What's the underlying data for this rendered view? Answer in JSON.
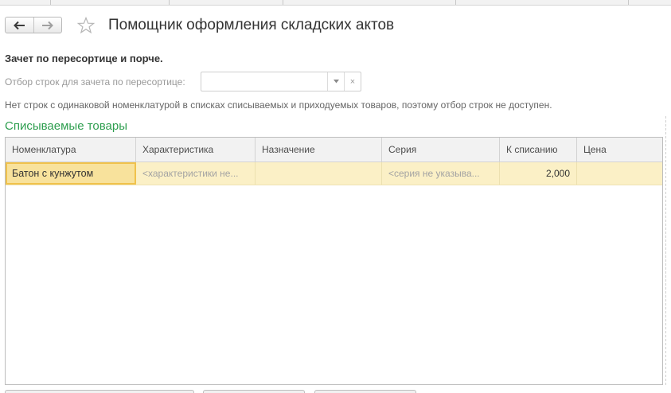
{
  "page_title": "Помощник оформления складских актов",
  "section_heading": "Зачет по пересортице и порче.",
  "filter": {
    "label": "Отбор строк для зачета по пересортице:",
    "value": "",
    "dropdown_glyph": "▾",
    "clear_glyph": "×"
  },
  "info_note": "Нет строк с одинаковой номенклатурой в списках списываемых и приходуемых товаров, поэтому отбор строк не доступен.",
  "group_title": "Списываемые товары",
  "table": {
    "columns": [
      "Номенклатура",
      "Характеристика",
      "Назначение",
      "Серия",
      "К списанию",
      "Цена"
    ],
    "rows": [
      {
        "nomenclature": "Батон с кунжутом",
        "characteristic": "<характеристики не...",
        "purpose": "",
        "series": "<серия не указыва...",
        "to_write_off": "2,000",
        "price": ""
      }
    ]
  },
  "colors": {
    "accent_green": "#2e9e4f",
    "row_highlight": "#fbf0c6",
    "active_cell_border": "#f0c24c"
  },
  "icons": {
    "back": "arrow-left-icon",
    "forward": "arrow-right-icon",
    "favorite": "star-icon",
    "dropdown": "chevron-down-icon",
    "clear": "close-icon"
  }
}
